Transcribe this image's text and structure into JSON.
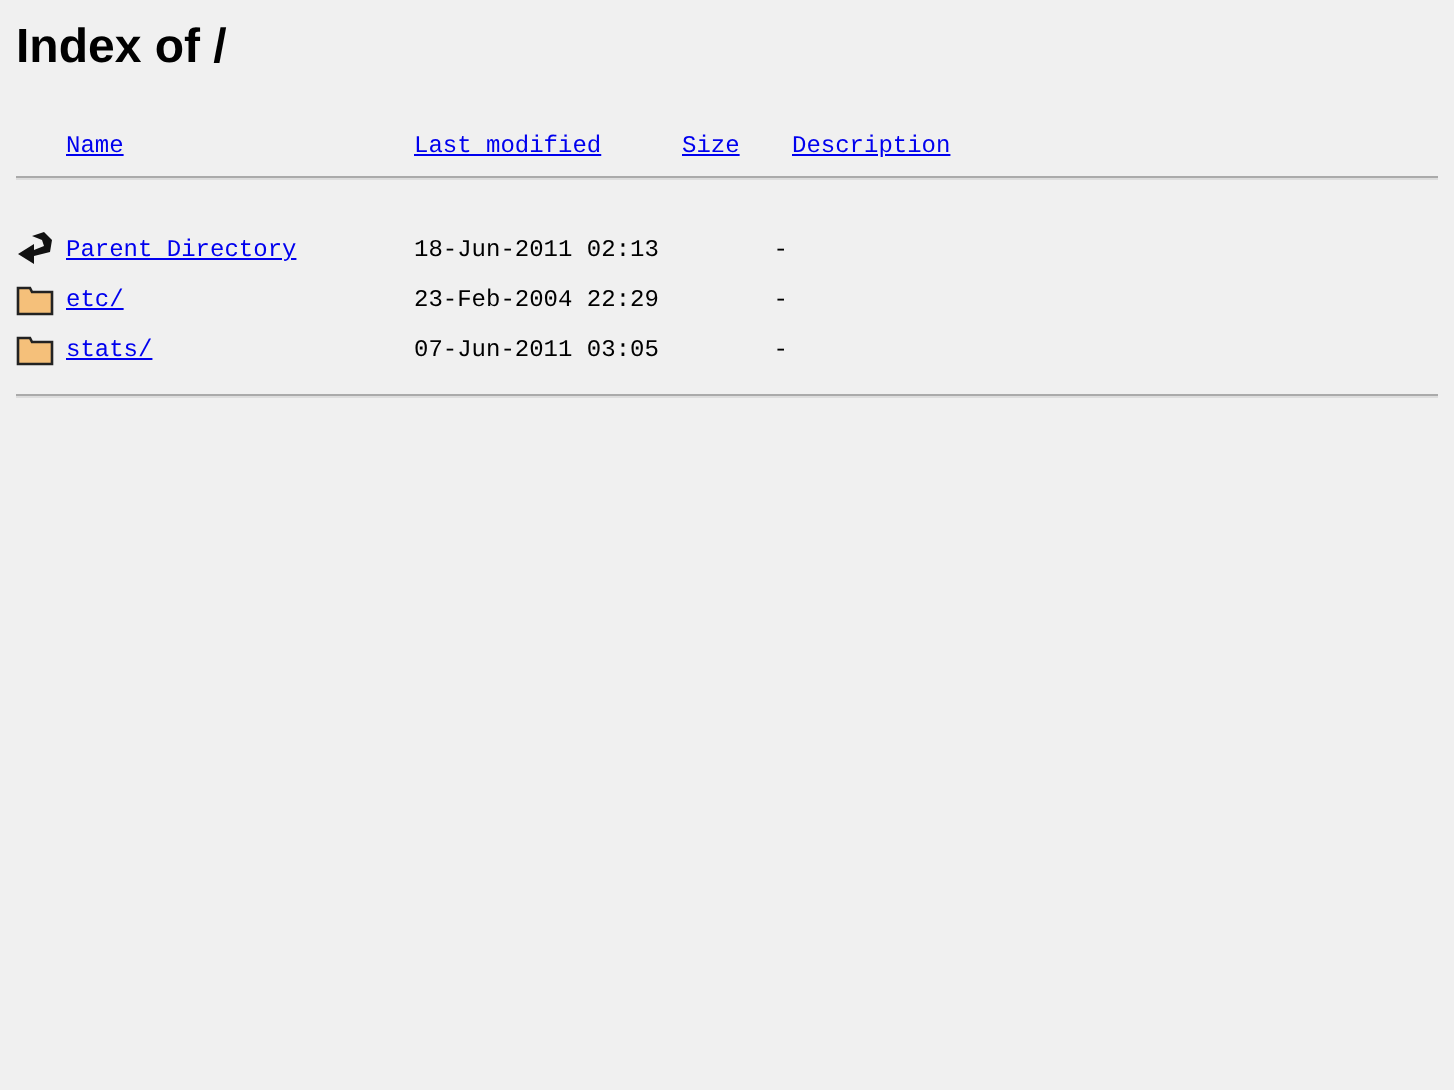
{
  "title": "Index of /",
  "columns": [
    "Name",
    "Last modified",
    "Size",
    "Description"
  ],
  "rows": [
    {
      "kind": "parent",
      "name": "Parent Directory",
      "modified": "18-Jun-2011 02:13",
      "size": "-"
    },
    {
      "kind": "folder",
      "name": "etc/",
      "modified": "23-Feb-2004 22:29",
      "size": "-"
    },
    {
      "kind": "folder",
      "name": "stats/",
      "modified": "07-Jun-2011 03:05",
      "size": "-"
    }
  ]
}
